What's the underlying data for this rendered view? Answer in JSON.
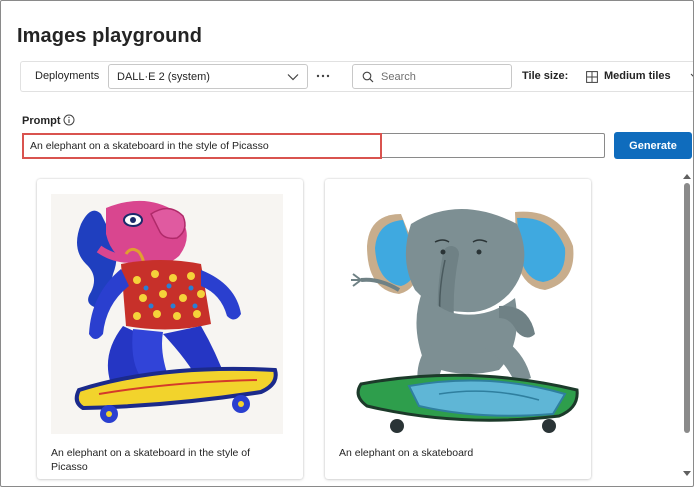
{
  "page": {
    "title": "Images playground"
  },
  "toolbar": {
    "deployments_label": "Deployments",
    "deployment_value": "DALL·E 2 (system)",
    "more_label": "···",
    "search_placeholder": "Search",
    "tile_size_label": "Tile size:",
    "tile_size_value": "Medium tiles"
  },
  "prompt": {
    "label": "Prompt",
    "value": "An elephant on a skateboard in the style of Picasso",
    "generate_label": "Generate"
  },
  "results": [
    {
      "caption": "An elephant on a skateboard in the style of Picasso"
    },
    {
      "caption": "An elephant on a skateboard"
    }
  ],
  "colors": {
    "accent": "#0f6cbd",
    "highlight": "#d9534f"
  },
  "icons": {
    "chevron": "chevron-down-icon",
    "more": "more-horizontal-icon",
    "search": "search-icon",
    "tile": "grid-icon",
    "info": "info-icon"
  }
}
